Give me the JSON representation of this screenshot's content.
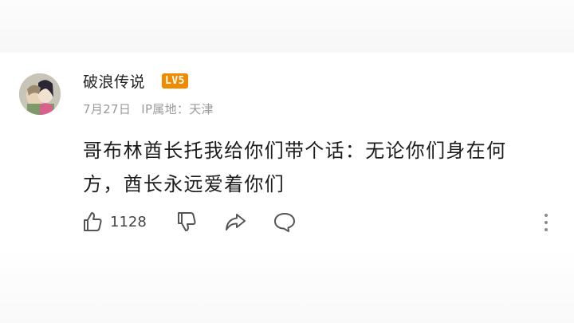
{
  "comment": {
    "user": {
      "name": "破浪传说",
      "level": "LV5"
    },
    "date": "7月27日",
    "ip_location": "IP属地：天津",
    "text": "哥布林酋长托我给你们带个话：无论你们身在何方，酋长永远爱着你们",
    "actions": {
      "like_count": "1128",
      "icons": [
        "thumbs-up-icon",
        "thumbs-down-icon",
        "share-icon",
        "comment-icon",
        "more-icon"
      ]
    }
  },
  "colors": {
    "text": "#1c1c1c",
    "meta": "#9a9a9a",
    "badge": "#f08a00",
    "icon": "#555555"
  }
}
